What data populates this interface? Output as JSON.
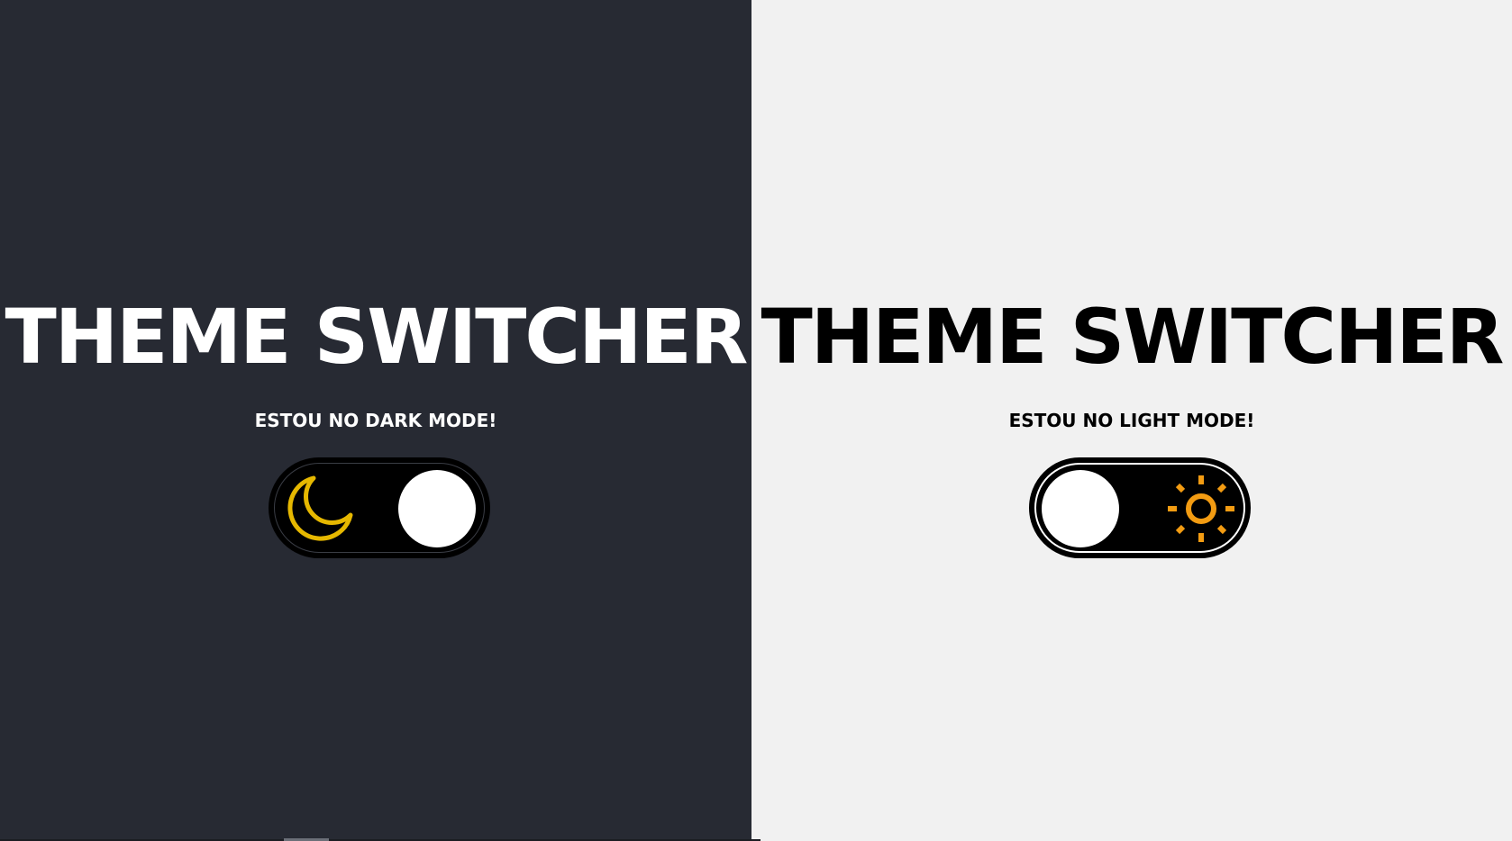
{
  "dark_panel": {
    "title": "THEME SWITCHER",
    "subtitle": "ESTOU NO DARK MODE!",
    "toggle": {
      "state": "dark",
      "icon": "moon-icon",
      "icon_color": "#e6b800"
    },
    "background": "#272a33",
    "text_color": "#ffffff"
  },
  "light_panel": {
    "title": "THEME SWITCHER",
    "subtitle": "ESTOU NO LIGHT MODE!",
    "toggle": {
      "state": "light",
      "icon": "sun-icon",
      "icon_color": "#f39c12"
    },
    "background": "#f1f1f1",
    "text_color": "#000000"
  }
}
